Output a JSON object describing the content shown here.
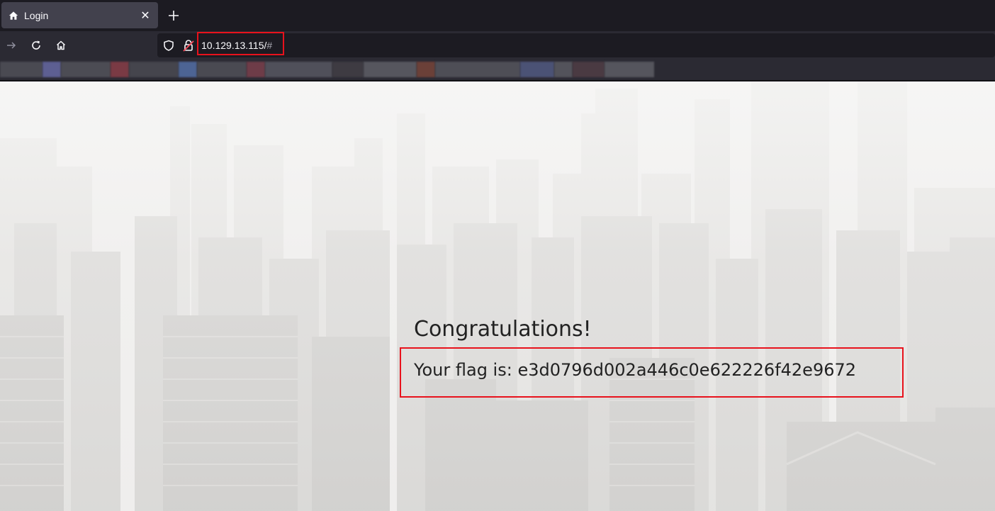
{
  "browser": {
    "tab": {
      "title": "Login",
      "favicon": "home-icon",
      "close_glyph": "✕"
    },
    "new_tab_icon": "plus-icon",
    "nav": {
      "back_icon": "arrow-right-icon",
      "reload_icon": "reload-icon",
      "home_icon": "home-icon"
    },
    "urlbar": {
      "shield_icon": "shield-icon",
      "lock_icon": "insecure-lock-icon",
      "url_host": "10.129.13.115/",
      "url_hash": "#"
    }
  },
  "page": {
    "heading": "Congratulations!",
    "flag_text": "Your flag is: e3d0796d002a446c0e622226f42e9672"
  },
  "colors": {
    "highlight": "#e8121c",
    "chrome_dark": "#1c1b22",
    "chrome": "#2b2a33",
    "tab_active": "#42414d",
    "text_light": "#fbfbfe",
    "page_text": "#222222"
  }
}
